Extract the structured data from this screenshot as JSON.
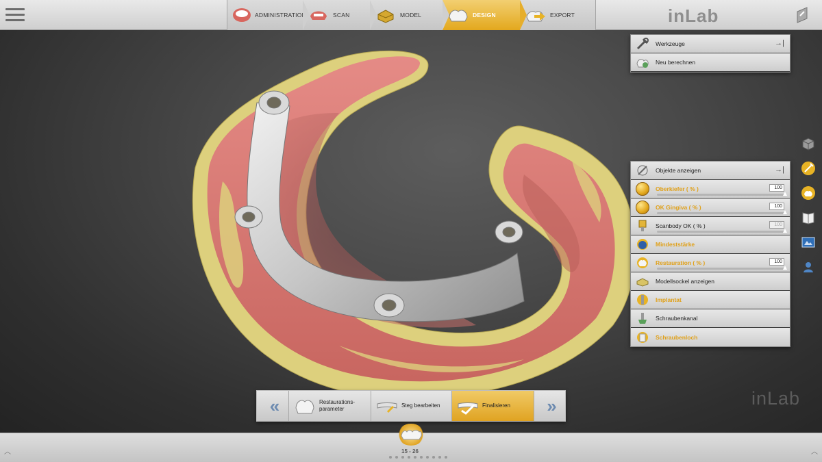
{
  "app": {
    "logo": "inLab",
    "watermark": "inLab"
  },
  "workflow": {
    "steps": [
      {
        "label": "ADMINISTRATION",
        "icon": "denture-icon",
        "active": false
      },
      {
        "label": "SCAN",
        "icon": "scan-jaw-icon",
        "active": false
      },
      {
        "label": "MODEL",
        "icon": "model-block-icon",
        "active": false
      },
      {
        "label": "DESIGN",
        "icon": "crown-design-icon",
        "active": true
      },
      {
        "label": "EXPORT",
        "icon": "export-arrow-icon",
        "active": false
      }
    ]
  },
  "tools_panel": {
    "rows": [
      {
        "label": "Werkzeuge",
        "icon": "tools-icon",
        "pin": "→|"
      },
      {
        "label": "Neu berechnen",
        "icon": "recalculate-icon"
      }
    ]
  },
  "objects_panel": {
    "header": {
      "label": "Objekte anzeigen",
      "icon": "eye-objects-icon",
      "pin": "→|"
    },
    "rows": [
      {
        "label": "Oberkiefer  ( % )",
        "value": "100",
        "highlight": true,
        "slider": 1.0,
        "icon": "upper-jaw-icon"
      },
      {
        "label": "OK Gingiva  ( % )",
        "value": "100",
        "highlight": true,
        "slider": 1.0,
        "icon": "gingiva-icon"
      },
      {
        "label": "Scanbody OK  ( % )",
        "value": "100",
        "highlight": false,
        "dim": true,
        "slider": 1.0,
        "icon": "scanbody-icon"
      },
      {
        "label": "Mindeststärke",
        "highlight": true,
        "icon": "min-thickness-icon"
      },
      {
        "label": "Restauration  ( % )",
        "value": "100",
        "highlight": true,
        "slider": 1.0,
        "icon": "restoration-icon"
      },
      {
        "label": "Modellsockel anzeigen",
        "highlight": false,
        "icon": "model-base-icon"
      },
      {
        "label": "Implantat",
        "highlight": true,
        "icon": "implant-icon"
      },
      {
        "label": "Schraubenkanal",
        "highlight": false,
        "icon": "screw-channel-icon"
      },
      {
        "label": "Schraubenloch",
        "highlight": true,
        "icon": "screw-hole-icon"
      }
    ]
  },
  "side_icons": [
    "cube-view-icon",
    "tools-circle-icon",
    "analysis-icon",
    "book-icon",
    "screenshot-icon",
    "user-help-icon"
  ],
  "wizard": {
    "prev": "«",
    "next": "»",
    "steps": [
      {
        "label": "Restaurations-\nparameter",
        "icon": "crown-params-icon",
        "active": false
      },
      {
        "label": "Steg bearbeiten",
        "icon": "bar-edit-icon",
        "active": false
      },
      {
        "label": "Finalisieren",
        "icon": "finalize-icon",
        "active": true
      }
    ]
  },
  "bottom": {
    "tooth_range": "15 - 26"
  },
  "colors": {
    "accent": "#e3a81d",
    "gingiva": "#dd7b7b",
    "model": "#e2d382",
    "bar": "#c9c9c9"
  }
}
